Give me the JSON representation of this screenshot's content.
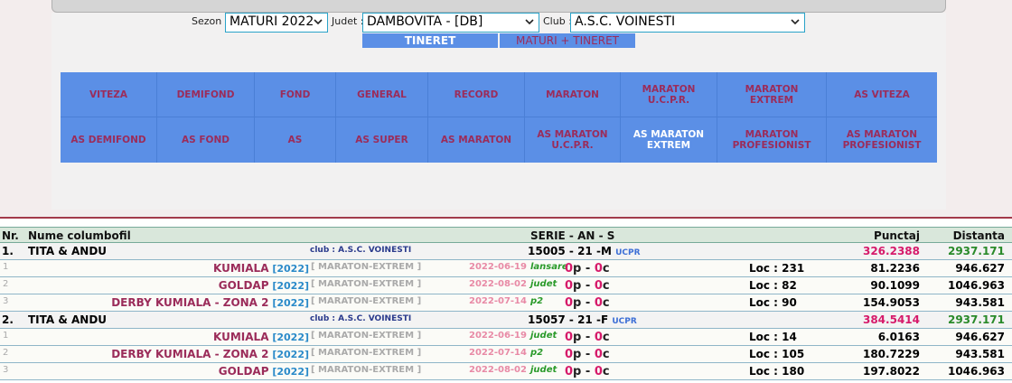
{
  "filters": {
    "sezon_label": "Sezon :",
    "sezon_value": "MATURI 2022",
    "judet_label": "Judet :",
    "judet_value": "DAMBOVITA -  [DB]",
    "club_label": "Club :",
    "club_value": "A.S.C. VOINESTI"
  },
  "tabs": [
    {
      "label": "TINERET"
    },
    {
      "label": "MATURI + TINERET"
    }
  ],
  "categories_row1": [
    {
      "label": "VITEZA"
    },
    {
      "label": "DEMIFOND"
    },
    {
      "label": "FOND"
    },
    {
      "label": "GENERAL"
    },
    {
      "label": "RECORD"
    },
    {
      "label": "MARATON"
    },
    {
      "label": "MARATON U.C.P.R."
    },
    {
      "label": "MARATON EXTREM"
    },
    {
      "label": "AS VITEZA"
    }
  ],
  "categories_row2": [
    {
      "label": "AS DEMIFOND"
    },
    {
      "label": "AS FOND"
    },
    {
      "label": "AS"
    },
    {
      "label": "AS SUPER"
    },
    {
      "label": "AS MARATON"
    },
    {
      "label": "AS MARATON U.C.P.R."
    },
    {
      "label": "AS MARATON EXTREM"
    },
    {
      "label": "MARATON PROFESIONIST"
    },
    {
      "label": "AS MARATON PROFESIONIST"
    }
  ],
  "table": {
    "headers": {
      "nr": "Nr.",
      "name": "Nume columbofil",
      "serie": "SERIE - AN - S",
      "punctaj": "Punctaj",
      "distanta": "Distanta"
    },
    "entries": [
      {
        "nr": "1.",
        "name": "TITA & ANDU",
        "club": "club : A.S.C. VOINESTI",
        "serie": "15005 - 21 -M",
        "tag": "UCPR",
        "punctaj": "326.2388",
        "distanta": "2937.171",
        "races": [
          {
            "idx": "1",
            "race": "KUMIALA",
            "year": "[2022]",
            "type": "[ MARATON-EXTREM ]",
            "date": "2022-06-19",
            "kind": "lansare",
            "p": "0",
            "p_unit": "p -",
            "c": "0",
            "c_unit": "c",
            "loc": "Loc : 231",
            "points": "81.2236",
            "dist": "946.627"
          },
          {
            "idx": "2",
            "race": "GOLDAP",
            "year": "[2022]",
            "type": "[ MARATON-EXTREM ]",
            "date": "2022-08-02",
            "kind": "judet",
            "p": "0",
            "p_unit": "p -",
            "c": "0",
            "c_unit": "c",
            "loc": "Loc : 82",
            "points": "90.1099",
            "dist": "1046.963"
          },
          {
            "idx": "3",
            "race": "DERBY KUMIALA - ZONA 2",
            "year": "[2022]",
            "type": "[ MARATON-EXTREM ]",
            "date": "2022-07-14",
            "kind": "p2",
            "p": "0",
            "p_unit": "p -",
            "c": "0",
            "c_unit": "c",
            "loc": "Loc : 90",
            "points": "154.9053",
            "dist": "943.581"
          }
        ]
      },
      {
        "nr": "2.",
        "name": "TITA & ANDU",
        "club": "club : A.S.C. VOINESTI",
        "serie": "15057 - 21 -F",
        "tag": "UCPR",
        "punctaj": "384.5414",
        "distanta": "2937.171",
        "races": [
          {
            "idx": "1",
            "race": "KUMIALA",
            "year": "[2022]",
            "type": "[ MARATON-EXTREM ]",
            "date": "2022-06-19",
            "kind": "judet",
            "p": "0",
            "p_unit": "p -",
            "c": "0",
            "c_unit": "c",
            "loc": "Loc : 14",
            "points": "6.0163",
            "dist": "946.627"
          },
          {
            "idx": "2",
            "race": "DERBY KUMIALA - ZONA 2",
            "year": "[2022]",
            "type": "[ MARATON-EXTREM ]",
            "date": "2022-07-14",
            "kind": "p2",
            "p": "0",
            "p_unit": "p -",
            "c": "0",
            "c_unit": "c",
            "loc": "Loc : 105",
            "points": "180.7229",
            "dist": "943.581"
          },
          {
            "idx": "3",
            "race": "GOLDAP",
            "year": "[2022]",
            "type": "[ MARATON-EXTREM ]",
            "date": "2022-08-02",
            "kind": "judet",
            "p": "0",
            "p_unit": "p -",
            "c": "0",
            "c_unit": "c",
            "loc": "Loc : 180",
            "points": "197.8022",
            "dist": "1046.963"
          }
        ]
      }
    ]
  }
}
